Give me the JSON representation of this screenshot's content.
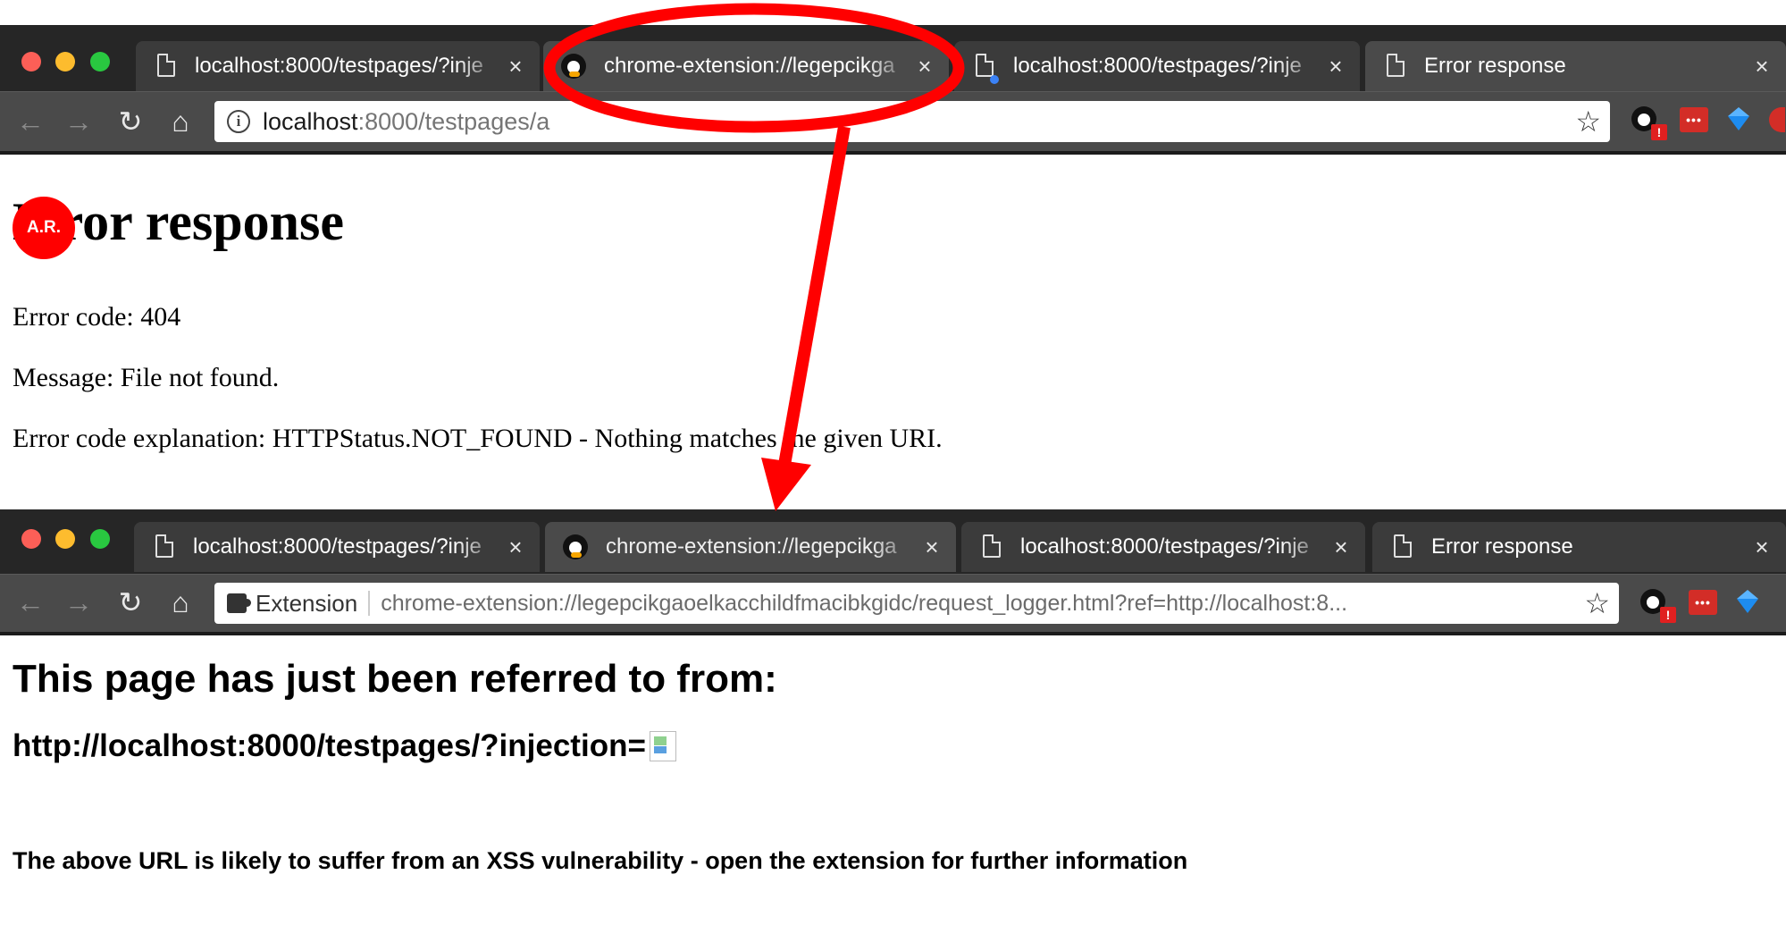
{
  "top_browser": {
    "tabs": [
      {
        "title": "localhost:8000/testpages/?inje",
        "close": "×"
      },
      {
        "title": "chrome-extension://legepcikga",
        "close": "×"
      },
      {
        "title": "localhost:8000/testpages/?inje",
        "close": "×"
      },
      {
        "title": "Error response",
        "close": "×"
      }
    ],
    "url_host": "localhost",
    "url_rest": ":8000/testpages/a"
  },
  "error_page": {
    "heading": "Error response",
    "heading_visible": "rror response",
    "code": "Error code: 404",
    "message": "Message: File not found.",
    "explanation": "Error code explanation: HTTPStatus.NOT_FOUND - Nothing matches the given URI."
  },
  "ar_badge": "A.R.",
  "bottom_browser": {
    "tabs": [
      {
        "title": "localhost:8000/testpages/?inje",
        "close": "×"
      },
      {
        "title": "chrome-extension://legepcikga",
        "close": "×"
      },
      {
        "title": "localhost:8000/testpages/?inje",
        "close": "×"
      },
      {
        "title": "Error response",
        "close": "×"
      }
    ],
    "chip_label": "Extension",
    "url": "chrome-extension://legepcikgaoelkacchildfmacibkgidc/request_logger.html?ref=http://localhost:8..."
  },
  "logger_page": {
    "heading": "This page has just been referred to from:",
    "referrer": "http://localhost:8000/testpages/?injection=",
    "note": "The above URL is likely to suffer from an XSS vulnerability - open the extension for further information"
  },
  "icons": {
    "back": "back-arrow-icon",
    "forward": "forward-arrow-icon",
    "reload": "reload-icon",
    "home": "home-icon",
    "star": "star-icon",
    "info": "info-icon",
    "extension": "puzzle-icon"
  },
  "colors": {
    "annotation": "#ff0000",
    "tabstrip": "#262626",
    "toolbar": "#4a4a4a"
  }
}
